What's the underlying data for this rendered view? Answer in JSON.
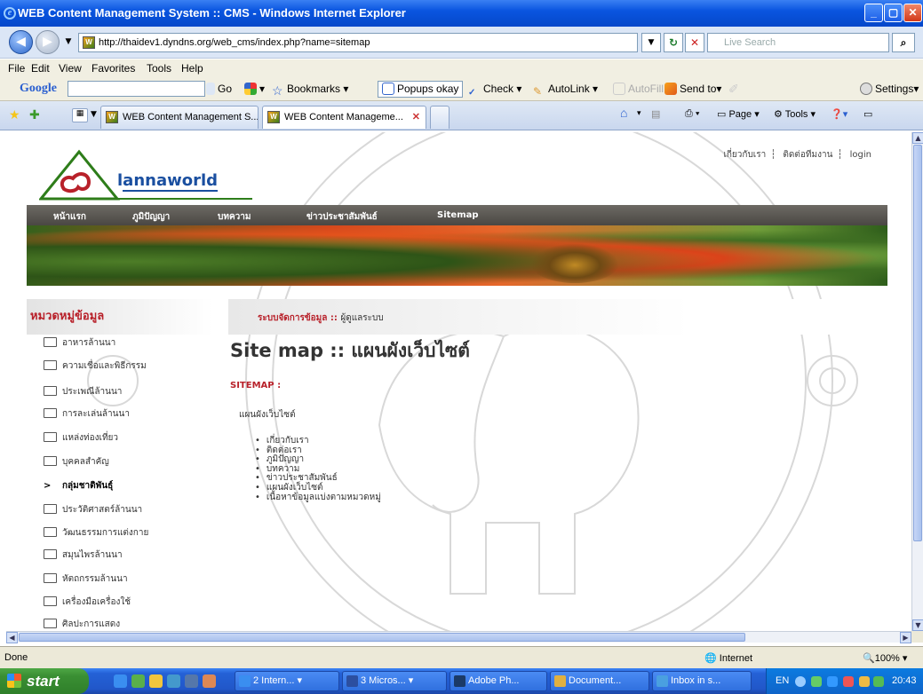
{
  "window": {
    "title": "WEB Content Management System :: CMS - Windows Internet Explorer"
  },
  "addressbar": {
    "url": "http://thaidev1.dyndns.org/web_cms/index.php?name=sitemap",
    "search_placeholder": "Live Search"
  },
  "menu": [
    "File",
    "Edit",
    "View",
    "Favorites",
    "Tools",
    "Help"
  ],
  "google_toolbar": {
    "logo": "Google",
    "go": "Go",
    "bookmarks": "Bookmarks",
    "popups": "Popups okay",
    "check": "Check",
    "autolink": "AutoLink",
    "autofill": "AutoFill",
    "sendto": "Send to",
    "settings": "Settings"
  },
  "tabs": [
    {
      "title": "WEB Content Management S..."
    },
    {
      "title": "WEB Content Manageme..."
    }
  ],
  "command_bar": {
    "page": "Page",
    "tools": "Tools"
  },
  "page": {
    "logo_text": "annaworld",
    "logo_prefix": "l",
    "top_links": [
      "เกี่ยวกับเรา",
      "ติดต่อทีมงาน",
      "login"
    ],
    "nav": [
      "หน้าแรก",
      "ภูมิปัญญา",
      "บทความ",
      "ข่าวประชาสัมพันธ์",
      "Sitemap"
    ],
    "sidebar": {
      "title": "หมวดหมู่ข้อมูล",
      "items": [
        "อาหารล้านนา",
        "ความเชื่อและพิธีกรรม",
        "ประเพณีล้านนา",
        "การละเล่นล้านนา",
        "แหล่งท่องเที่ยว",
        "บุคคลสำคัญ",
        "กลุ่มชาติพันธุ์",
        "ประวัติศาสตร์ล้านนา",
        "วัฒนธรรมการแต่งกาย",
        "สมุนไพรล้านนา",
        "หัตถกรรมล้านนา",
        "เครื่องมือเครื่องใช้",
        "ศิลปะการแสดง"
      ],
      "active_index": 6
    },
    "breadcrumb": {
      "main": "ระบบจัดการข้อมูล ::",
      "sub": "ผู้ดูแลระบบ"
    },
    "heading": "Site map :: แผนผังเว็บไซต์",
    "sitemap_label": "SITEMAP :",
    "tree_label": "แผนผังเว็บไซต์",
    "links": [
      "เกี่ยวกับเรา",
      "ติดต่อเรา",
      "ภูมิปัญญา",
      "บทความ",
      "ข่าวประชาสัมพันธ์",
      "แผนผังเว็บไซต์",
      "เนื้อหาข้อมูลแบ่งตามหมวดหมู่"
    ]
  },
  "statusbar": {
    "left": "Done",
    "zone": "Internet",
    "zoom": "100%"
  },
  "taskbar": {
    "start": "start",
    "tasks": [
      "2 Intern...",
      "3 Micros...",
      "Adobe Ph...",
      "Document...",
      "Inbox in s..."
    ],
    "lang": "EN",
    "clock": "20:43"
  },
  "colors": {
    "accent": "#b8212a",
    "nav_bg": "#5a5752",
    "logo_green": "#2e7d1a",
    "logo_blue": "#1a4fa0"
  }
}
